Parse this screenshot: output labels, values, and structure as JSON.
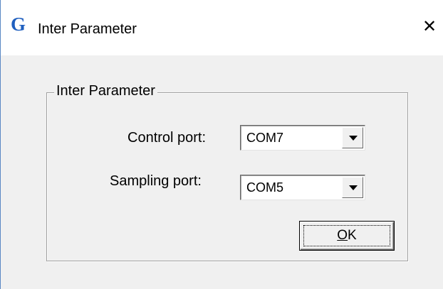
{
  "window": {
    "title": "Inter Parameter",
    "icon": "G",
    "close_glyph": "✕"
  },
  "group": {
    "legend": "Inter Parameter"
  },
  "fields": {
    "control_port": {
      "label": "Control port:",
      "value": "COM7"
    },
    "sampling_port": {
      "label": "Sampling port:",
      "value": "COM5"
    }
  },
  "buttons": {
    "ok_mnemonic": "O",
    "ok_rest": "K"
  },
  "colors": {
    "icon": "#1f5fbf",
    "face": "#f0f0f0"
  }
}
